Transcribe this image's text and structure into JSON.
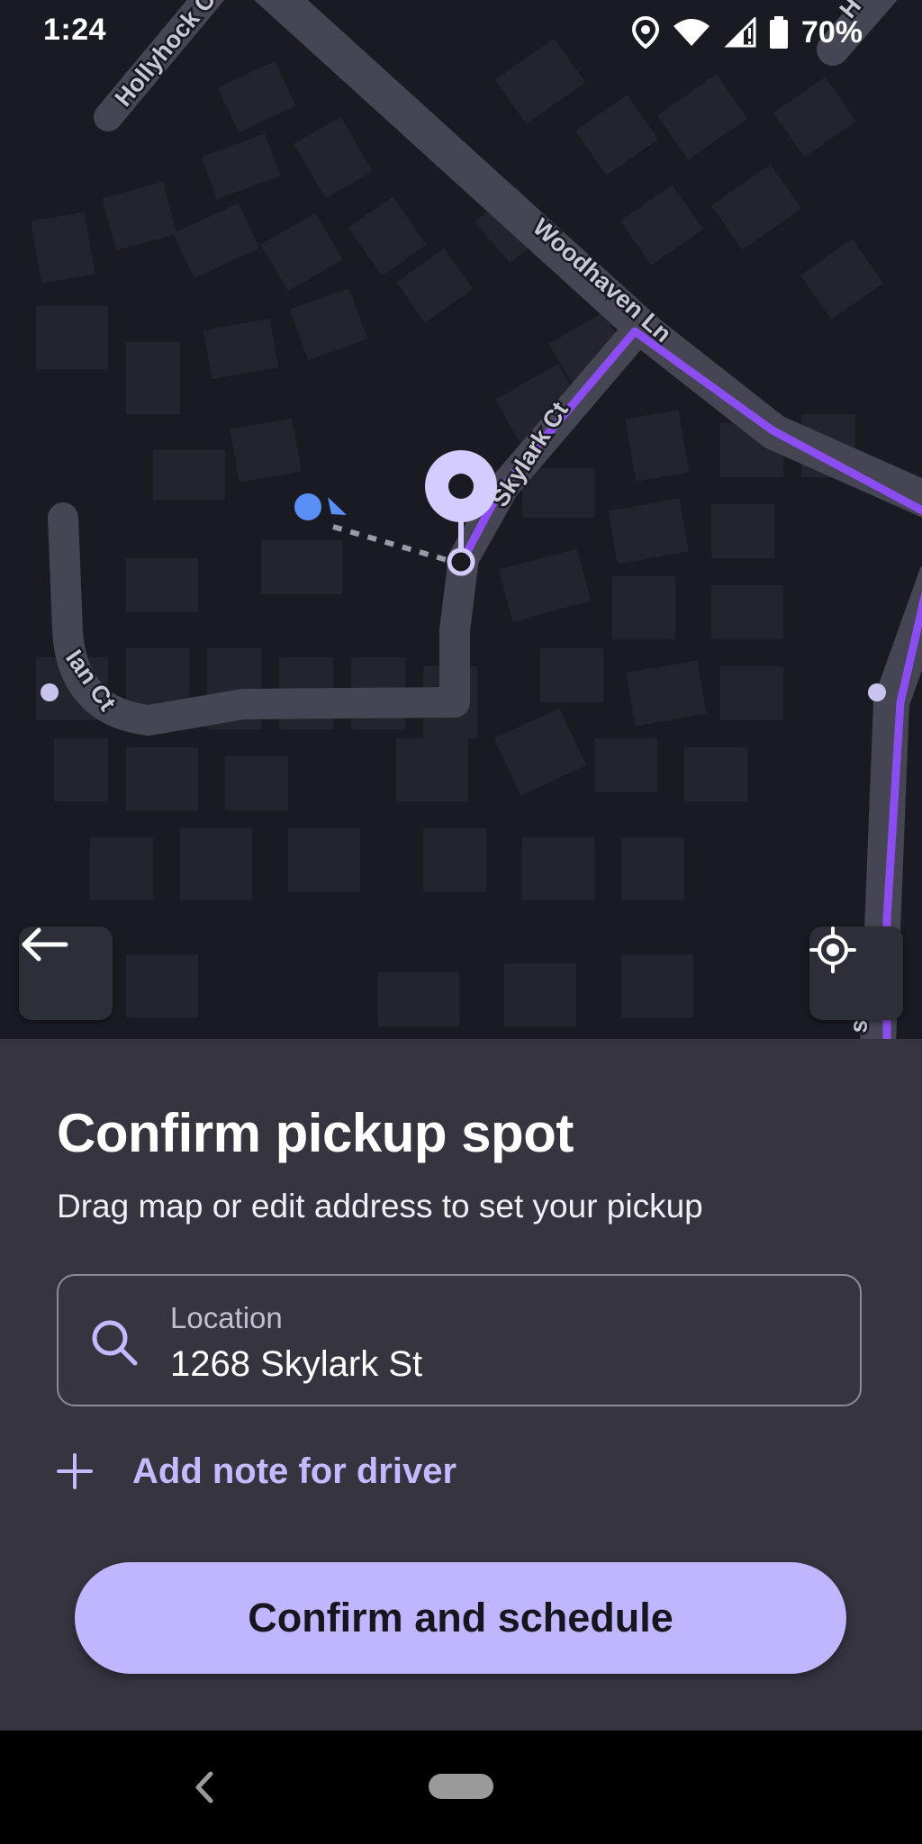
{
  "status_bar": {
    "time": "1:24",
    "battery_percent": "70%",
    "icons": [
      "location-icon",
      "wifi-icon",
      "cell-signal-icon",
      "battery-icon"
    ]
  },
  "map": {
    "street_labels": {
      "hollyhock": "Hollyhock C",
      "woodhaven": "Woodhaven Ln",
      "skylark": "Skylark Ct",
      "ian": "Ian Ct",
      "top_right": "H",
      "right_edge": "s"
    },
    "colors": {
      "background": "#1a1a22",
      "road": "#454553",
      "route": "#8b4df0",
      "pin": "#d4cbff",
      "user_dot": "#5b8ff8"
    }
  },
  "buttons": {
    "back_icon": "arrow-left-icon",
    "recenter_icon": "crosshair-icon"
  },
  "sheet": {
    "title": "Confirm pickup spot",
    "subtitle": "Drag map or edit address to set your pickup",
    "location": {
      "label": "Location",
      "value": "1268 Skylark St",
      "icon": "search-icon"
    },
    "add_note": "Add note for driver",
    "confirm": "Confirm and schedule"
  },
  "colors": {
    "sheet_bg": "#35343f",
    "accent": "#c0b5ff",
    "accent_text": "#c5b9ff"
  }
}
